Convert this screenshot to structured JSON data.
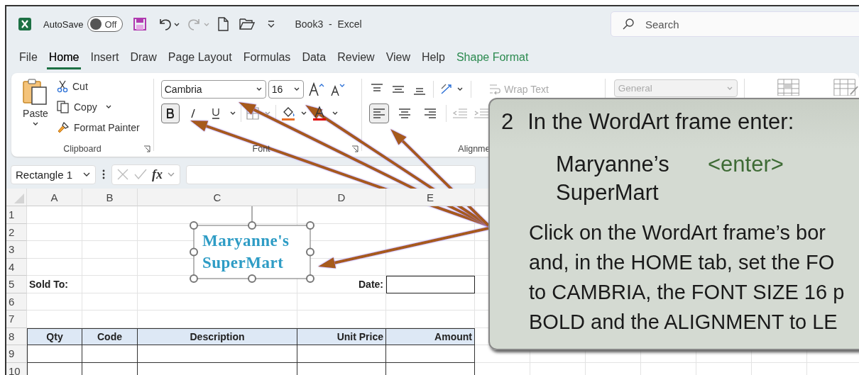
{
  "title_bar": {
    "autosave_label": "AutoSave",
    "autosave_toggle": {
      "label": "Off",
      "on": false
    },
    "document_title": "Book3  -  Excel",
    "search": {
      "placeholder": "Search"
    }
  },
  "tabs": [
    {
      "label": "File",
      "selected": false,
      "kind": "normal"
    },
    {
      "label": "Home",
      "selected": true,
      "kind": "normal"
    },
    {
      "label": "Insert",
      "selected": false,
      "kind": "normal"
    },
    {
      "label": "Draw",
      "selected": false,
      "kind": "normal"
    },
    {
      "label": "Page Layout",
      "selected": false,
      "kind": "normal"
    },
    {
      "label": "Formulas",
      "selected": false,
      "kind": "normal"
    },
    {
      "label": "Data",
      "selected": false,
      "kind": "normal"
    },
    {
      "label": "Review",
      "selected": false,
      "kind": "normal"
    },
    {
      "label": "View",
      "selected": false,
      "kind": "normal"
    },
    {
      "label": "Help",
      "selected": false,
      "kind": "normal"
    },
    {
      "label": "Shape Format",
      "selected": false,
      "kind": "contextual"
    }
  ],
  "ribbon": {
    "clipboard": {
      "label": "Clipboard",
      "paste": "Paste",
      "cut": "Cut",
      "copy": "Copy",
      "format_painter": "Format Painter"
    },
    "font": {
      "label": "Font",
      "font_name": "Cambria",
      "font_size": "16",
      "bold": true,
      "italic": false,
      "underline": false
    },
    "alignment": {
      "label": "Alignme",
      "wrap_text": "Wrap Text",
      "align_left": true,
      "align_center": false,
      "align_right": false
    },
    "number": {
      "format": "General",
      "disabled": true
    }
  },
  "formula_bar": {
    "name_box": "Rectangle 1",
    "function_label": "fx"
  },
  "sheet": {
    "columns": [
      "A",
      "B",
      "C",
      "D",
      "E"
    ],
    "row_numbers": [
      "1",
      "2",
      "3",
      "4",
      "5",
      "6",
      "7",
      "8",
      "9",
      "10"
    ],
    "sold_to_label": "Sold To:",
    "date_label": "Date:",
    "table_headers": [
      "Qty",
      "Code",
      "Description",
      "Unit Price",
      "Amount"
    ],
    "wordart": {
      "lines": [
        "Maryanne's",
        "SuperMart"
      ]
    }
  },
  "callout": {
    "step": "2",
    "heading": "In the WordArt frame enter:",
    "entry_lines": [
      {
        "text": "Maryanne’s",
        "key": "<enter>"
      },
      {
        "text": "SuperMart"
      }
    ],
    "instruction": "Click on the WordArt frame’s bor\nand, in the HOME tab, set the FO\nto CAMBRIA, the FONT SIZE 16 p\nBOLD and the ALIGNMENT to LE"
  }
}
